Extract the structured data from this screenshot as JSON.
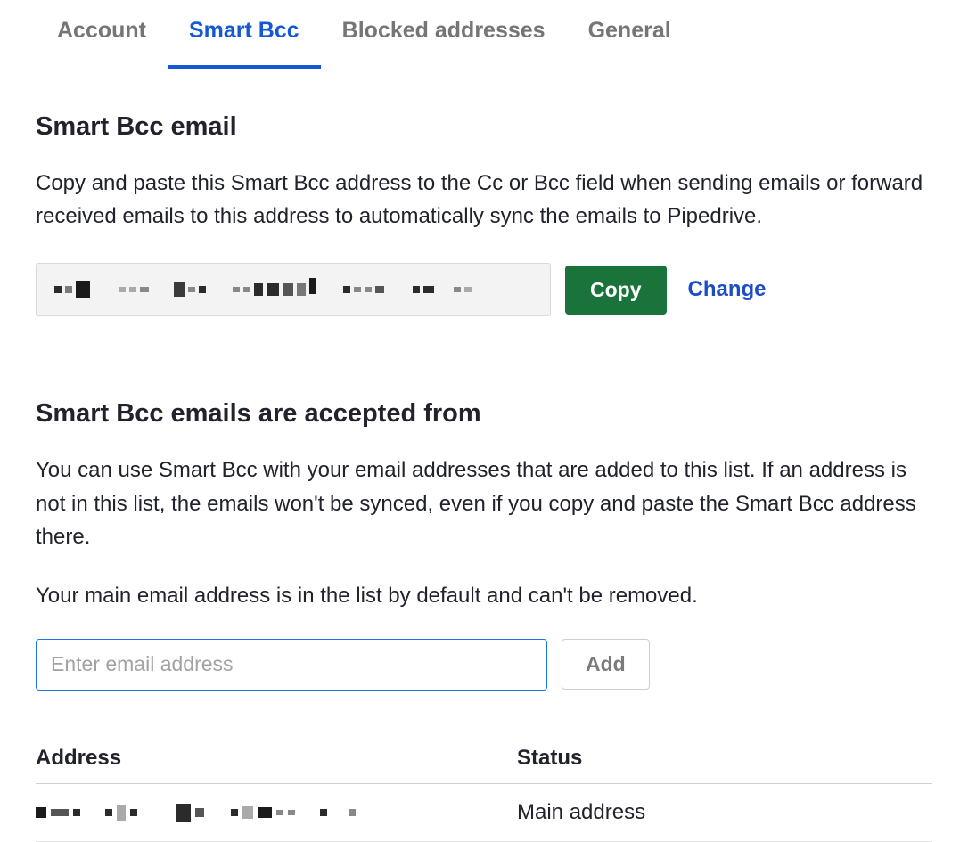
{
  "tabs": {
    "account": "Account",
    "smart_bcc": "Smart Bcc",
    "blocked": "Blocked addresses",
    "general": "General",
    "active": "smart_bcc"
  },
  "section1": {
    "title": "Smart Bcc email",
    "desc": "Copy and paste this Smart Bcc address to the Cc or Bcc field when sending emails or forward received emails to this address to automatically sync the emails to Pipedrive.",
    "bcc_address_redacted": true,
    "copy_label": "Copy",
    "change_label": "Change"
  },
  "section2": {
    "title": "Smart Bcc emails are accepted from",
    "desc": "You can use Smart Bcc with your email addresses that are added to this list. If an address is not in this list, the emails won't be synced, even if you copy and paste the Smart Bcc address there.",
    "note": "Your main email address is in the list by default and can't be removed.",
    "input_placeholder": "Enter email address",
    "add_label": "Add",
    "table": {
      "header_address": "Address",
      "header_status": "Status",
      "rows": [
        {
          "address_redacted": true,
          "status": "Main address"
        }
      ]
    }
  }
}
